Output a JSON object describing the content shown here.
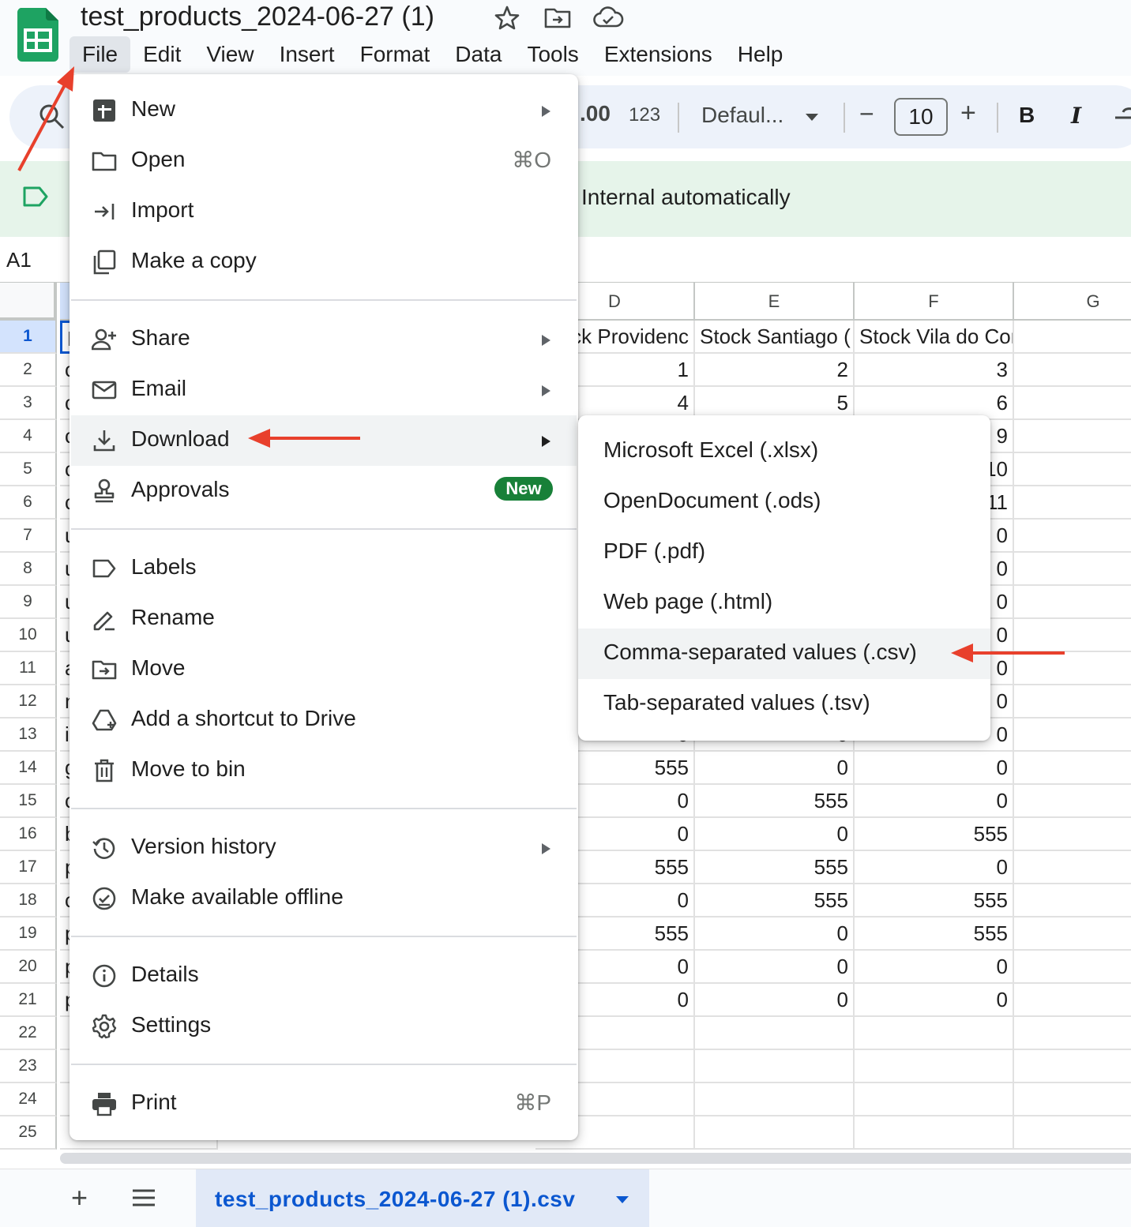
{
  "document": {
    "title": "test_products_2024-06-27 (1)",
    "banner_text": "Internal automatically",
    "cell_ref": "A1"
  },
  "menubar": [
    "File",
    "Edit",
    "View",
    "Insert",
    "Format",
    "Data",
    "Tools",
    "Extensions",
    "Help"
  ],
  "toolbar": {
    "decimal_increase": ".00",
    "number_format": "123",
    "font": "Defaul...",
    "font_size": "10",
    "minus": "−",
    "plus": "+",
    "bold": "B",
    "italic": "I"
  },
  "grid": {
    "columns": [
      "D",
      "E",
      "F",
      "G"
    ],
    "selected_row": 1,
    "rows": [
      {
        "n": "1",
        "a": "P",
        "d": "ck Providenc",
        "e": "Stock Santiago (",
        "f": "Stock Vila do Conde Depot"
      },
      {
        "n": "2",
        "a": "c",
        "d": "1",
        "e": "2",
        "f": "3"
      },
      {
        "n": "3",
        "a": "c",
        "d": "4",
        "e": "5",
        "f": "6"
      },
      {
        "n": "4",
        "a": "c",
        "d": "",
        "e": "",
        "f": "9"
      },
      {
        "n": "5",
        "a": "c",
        "d": "",
        "e": "",
        "f": "10"
      },
      {
        "n": "6",
        "a": "c",
        "d": "",
        "e": "",
        "f": "11"
      },
      {
        "n": "7",
        "a": "u",
        "d": "",
        "e": "",
        "f": "0"
      },
      {
        "n": "8",
        "a": "u",
        "d": "",
        "e": "",
        "f": "0"
      },
      {
        "n": "9",
        "a": "u",
        "d": "",
        "e": "",
        "f": "0"
      },
      {
        "n": "10",
        "a": "u",
        "d": "",
        "e": "",
        "f": "0"
      },
      {
        "n": "11",
        "a": "a",
        "d": "",
        "e": "",
        "f": "0"
      },
      {
        "n": "12",
        "a": "n",
        "d": "",
        "e": "",
        "f": "0"
      },
      {
        "n": "13",
        "a": "ip",
        "d": "0",
        "e": "0",
        "f": "0"
      },
      {
        "n": "14",
        "a": "g",
        "d": "555",
        "e": "0",
        "f": "0"
      },
      {
        "n": "15",
        "a": "c",
        "d": "0",
        "e": "555",
        "f": "0"
      },
      {
        "n": "16",
        "a": "b",
        "d": "0",
        "e": "0",
        "f": "555"
      },
      {
        "n": "17",
        "a": "p",
        "d": "555",
        "e": "555",
        "f": "0"
      },
      {
        "n": "18",
        "a": "c",
        "d": "0",
        "e": "555",
        "f": "555"
      },
      {
        "n": "19",
        "a": "p",
        "d": "555",
        "e": "0",
        "f": "555"
      },
      {
        "n": "20",
        "a": "p",
        "d": "0",
        "e": "0",
        "f": "0"
      },
      {
        "n": "21",
        "a": "p",
        "d": "0",
        "e": "0",
        "f": "0"
      },
      {
        "n": "22",
        "a": "",
        "d": "",
        "e": "",
        "f": ""
      },
      {
        "n": "23",
        "a": "",
        "d": "",
        "e": "",
        "f": ""
      },
      {
        "n": "24",
        "a": "",
        "d": "",
        "e": "",
        "f": ""
      },
      {
        "n": "25",
        "a": "",
        "d": "",
        "e": "",
        "f": ""
      }
    ]
  },
  "file_menu": {
    "items": [
      {
        "id": "new",
        "label": "New",
        "icon": "new-spreadsheet-icon",
        "submenu": true
      },
      {
        "id": "open",
        "label": "Open",
        "icon": "folder-icon",
        "shortcut": "⌘O"
      },
      {
        "id": "import",
        "label": "Import",
        "icon": "import-icon"
      },
      {
        "id": "make-copy",
        "label": "Make a copy",
        "icon": "copy-icon"
      },
      {
        "id": "share",
        "label": "Share",
        "icon": "person-add-icon",
        "submenu": true
      },
      {
        "id": "email",
        "label": "Email",
        "icon": "mail-icon",
        "submenu": true
      },
      {
        "id": "download",
        "label": "Download",
        "icon": "download-icon",
        "submenu": true,
        "highlighted": true
      },
      {
        "id": "approvals",
        "label": "Approvals",
        "icon": "approvals-stamp-icon",
        "badge": "New"
      },
      {
        "id": "labels",
        "label": "Labels",
        "icon": "label-icon"
      },
      {
        "id": "rename",
        "label": "Rename",
        "icon": "rename-pencil-icon"
      },
      {
        "id": "move",
        "label": "Move",
        "icon": "move-folder-icon"
      },
      {
        "id": "add-shortcut",
        "label": "Add a shortcut to Drive",
        "icon": "drive-shortcut-icon"
      },
      {
        "id": "move-to-bin",
        "label": "Move to bin",
        "icon": "trash-icon"
      },
      {
        "id": "version-history",
        "label": "Version history",
        "icon": "history-icon",
        "submenu": true
      },
      {
        "id": "offline",
        "label": "Make available offline",
        "icon": "offline-check-icon"
      },
      {
        "id": "details",
        "label": "Details",
        "icon": "info-icon"
      },
      {
        "id": "settings",
        "label": "Settings",
        "icon": "gear-icon"
      },
      {
        "id": "print",
        "label": "Print",
        "icon": "printer-icon",
        "shortcut": "⌘P"
      }
    ]
  },
  "download_menu": {
    "items": [
      {
        "label": "Microsoft Excel (.xlsx)"
      },
      {
        "label": "OpenDocument (.ods)"
      },
      {
        "label": "PDF (.pdf)"
      },
      {
        "label": "Web page (.html)"
      },
      {
        "label": "Comma-separated values (.csv)",
        "highlighted": true
      },
      {
        "label": "Tab-separated values (.tsv)"
      }
    ]
  },
  "sheet_tab": {
    "label": "test_products_2024-06-27 (1).csv",
    "add_label": "+"
  },
  "colors": {
    "annotation_arrow": "#e8402c",
    "sheets_green": "#1ea362",
    "active_blue": "#0b57d0",
    "badge_green": "#188038"
  }
}
